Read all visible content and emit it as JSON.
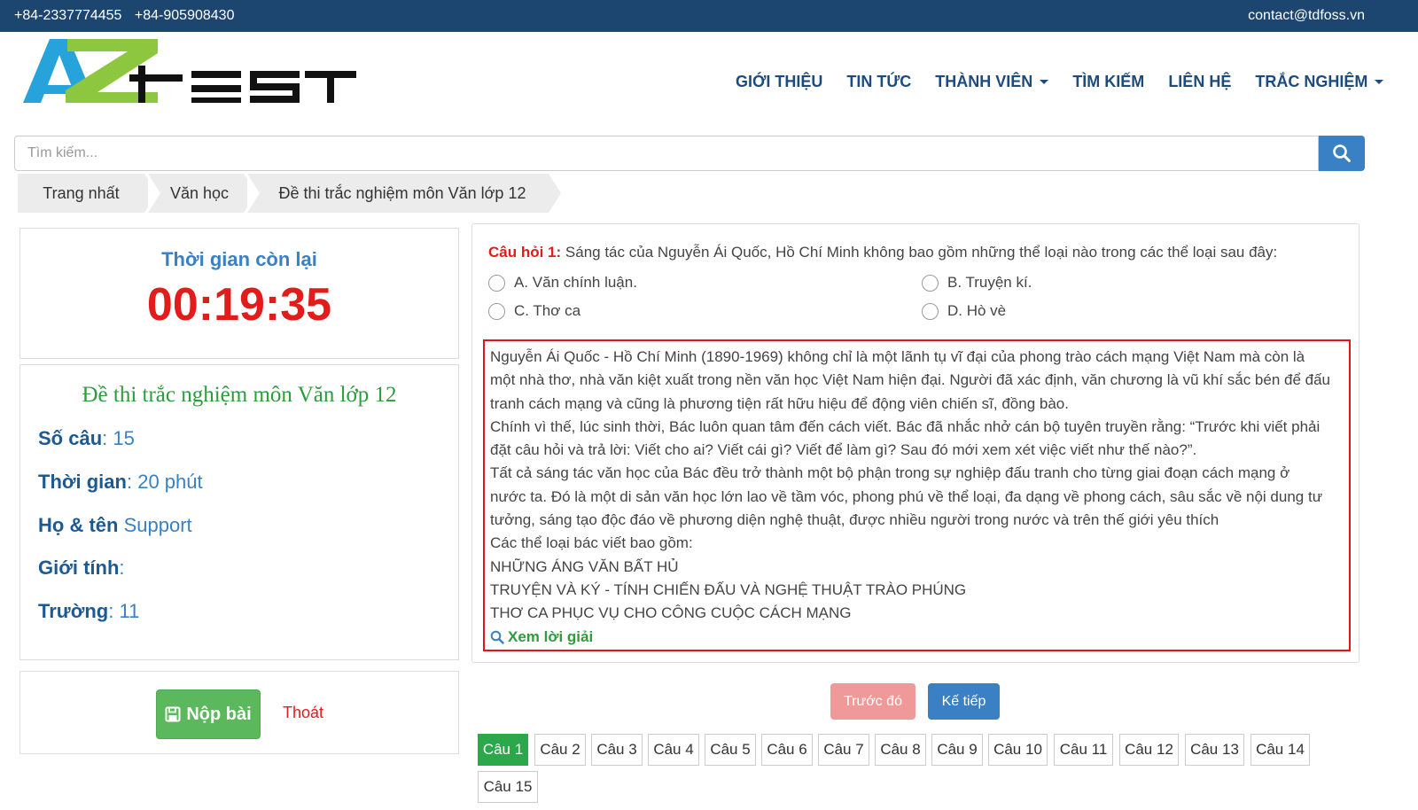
{
  "topbar": {
    "phone1": "+84-2337774455",
    "phone2": "+84-905908430",
    "email": "contact@tdfoss.vn"
  },
  "nav": {
    "items": [
      "GIỚI THIỆU",
      "TIN TỨC",
      "THÀNH VIÊN",
      "TÌM KIẾM",
      "LIÊN HỆ",
      "TRẮC NGHIỆM"
    ]
  },
  "search": {
    "placeholder": "Tìm kiếm..."
  },
  "breadcrumb": [
    "Trang nhất",
    "Văn học",
    "Đề thi trắc nghiệm môn Văn lớp 12"
  ],
  "timer": {
    "label": "Thời gian còn lại",
    "value": "00:19:35"
  },
  "exam": {
    "title": "Đề thi trắc nghiệm môn Văn lớp 12",
    "count_label": "Số câu",
    "count_value": "15",
    "time_label": "Thời gian",
    "time_value": "20 phút",
    "name_label": "Họ & tên",
    "name_value": "Support",
    "gender_label": "Giới tính",
    "gender_value": "",
    "school_label": "Trường",
    "school_value": "11"
  },
  "actions": {
    "submit": "Nộp bài",
    "exit": "Thoát"
  },
  "question": {
    "label": "Câu hỏi 1:",
    "text": "Sáng tác của Nguyễn Ái Quốc, Hồ Chí Minh không bao gồm những thể loại nào trong các thể loại sau đây:",
    "options": [
      "A. Văn chính luận.",
      "B. Truyện kí.",
      "C. Thơ ca",
      "D. Hò vè"
    ]
  },
  "answer": {
    "lines": [
      "Nguyễn Ái Quốc - Hồ Chí Minh (1890-1969) không chỉ là một lãnh tụ vĩ đại của phong trào cách mạng Việt Nam mà còn là",
      "một nhà thơ, nhà văn kiệt xuất trong nền văn học Việt Nam hiện đại. Người đã xác định, văn chương là vũ khí sắc bén để đấu",
      "tranh cách mạng và cũng là phương tiện rất hữu hiệu để động viên chiến sĩ, đồng bào.",
      "Chính vì thế, lúc sinh thời, Bác luôn quan tâm đến cách viết. Bác đã nhắc nhở cán bộ tuyên truyền rằng: “Trước khi viết phải",
      "đặt câu hỏi và trả lời: Viết cho ai? Viết cái gì? Viết để làm gì? Sau đó mới xem xét việc viết như thế nào?”.",
      "Tất cả sáng tác văn học của Bác đều trở thành một bộ phận trong sự nghiệp đấu tranh cho từng giai đoạn cách mạng ở",
      "nước ta. Đó là một di sản văn học lớn lao về tầm vóc, phong phú về thể loại, đa dạng về phong cách, sâu sắc về nội dung tư",
      "tưởng, sáng tạo độc đáo về phương diện nghệ thuật, được nhiều người trong nước và trên thế giới yêu thích",
      "Các thể loại bác viết bao gồm:",
      "NHỮNG ÁNG VĂN BẤT HỦ",
      "TRUYỆN VÀ KÝ - TÍNH CHIẾN ĐẤU VÀ NGHỆ THUẬT TRÀO PHÚNG",
      "THƠ CA PHỤC VỤ CHO CÔNG CUỘC CÁCH MẠNG"
    ],
    "view_solution": "Xem lời giải"
  },
  "pager": {
    "prev": "Trước đó",
    "next": "Kế tiếp"
  },
  "question_nav": [
    "Câu 1",
    "Câu 2",
    "Câu 3",
    "Câu 4",
    "Câu 5",
    "Câu 6",
    "Câu 7",
    "Câu 8",
    "Câu 9",
    "Câu 10",
    "Câu 11",
    "Câu 12",
    "Câu 13",
    "Câu 14",
    "Câu 15"
  ],
  "colors": {
    "topbar": "#1c4670",
    "accent": "#3a80c4",
    "danger": "#e21b1b",
    "success": "#2aa84a"
  }
}
